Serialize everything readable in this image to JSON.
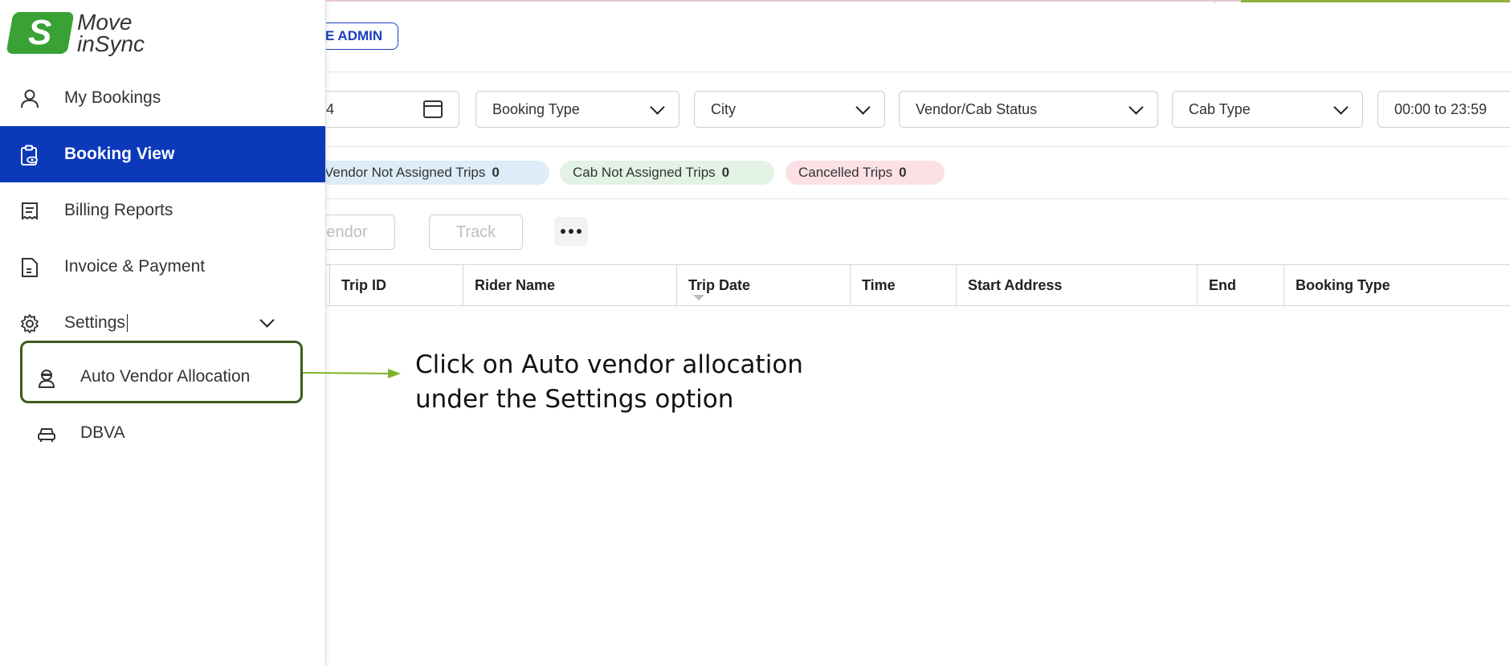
{
  "app": {
    "logo_mark": "S",
    "logo_line1": "Move",
    "logo_line2": "inSync"
  },
  "header": {
    "admin_pill": "E ADMIN"
  },
  "filters": {
    "date_partial": "4",
    "booking_type": "Booking Type",
    "city": "City",
    "vendor_cab_status": "Vendor/Cab Status",
    "cab_type": "Cab Type",
    "time_range": "00:00 to 23:59"
  },
  "chips": [
    {
      "label": "Vendor Not Assigned Trips",
      "count": "0",
      "color": "#dcecf8"
    },
    {
      "label": "Cab Not Assigned Trips",
      "count": "0",
      "color": "#e2f2e4"
    },
    {
      "label": "Cancelled Trips",
      "count": "0",
      "color": "#fbe1e6"
    }
  ],
  "actions": {
    "vendor_partial": "endor",
    "track": "Track"
  },
  "table": {
    "headers": [
      "Trip ID",
      "Rider Name",
      "Trip Date",
      "Time",
      "Start Address",
      "End",
      "Booking Type"
    ]
  },
  "sidebar": {
    "items": [
      {
        "label": "My Bookings",
        "icon": "person-icon"
      },
      {
        "label": "Booking View",
        "icon": "clipboard-eye-icon"
      },
      {
        "label": "Billing Reports",
        "icon": "receipt-icon"
      },
      {
        "label": "Invoice & Payment",
        "icon": "document-icon"
      },
      {
        "label": "Settings",
        "icon": "gear-icon"
      }
    ],
    "sub_items": [
      {
        "label": "Auto Vendor Allocation",
        "icon": "driver-icon"
      },
      {
        "label": "DBVA",
        "icon": "car-icon"
      }
    ]
  },
  "annotation": {
    "text": "Click on Auto vendor allocation\nunder the Settings option"
  },
  "colors": {
    "brand_blue": "#0b39b9",
    "brand_green": "#3aa135",
    "highlight_border": "#3e5a1e",
    "arrow": "#7fb42a"
  }
}
